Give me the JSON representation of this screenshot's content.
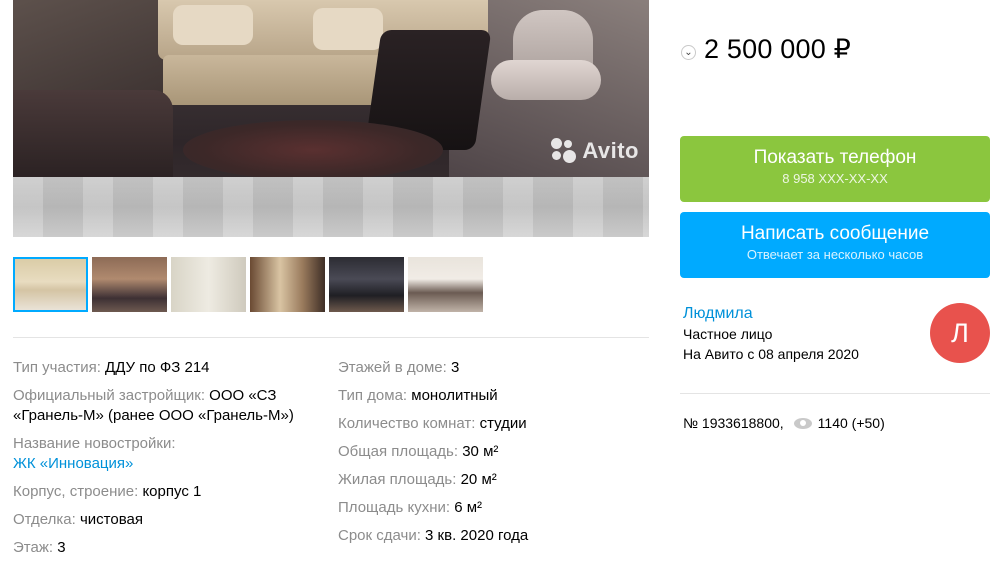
{
  "photo": {
    "watermark": "Avito"
  },
  "thumbnails": [
    {
      "id": "t1",
      "active": true
    },
    {
      "id": "t2",
      "active": false
    },
    {
      "id": "t3",
      "active": false
    },
    {
      "id": "t4",
      "active": false
    },
    {
      "id": "t5",
      "active": false
    },
    {
      "id": "t6",
      "active": false
    }
  ],
  "params": {
    "col1": [
      {
        "key": "Тип участия: ",
        "value": "ДДУ по ФЗ 214"
      },
      {
        "key": "Официальный застройщик: ",
        "value": "ООО «СЗ «Гранель-М» (ранее ООО «Гранель-М»)"
      },
      {
        "key": "Название новостройки:",
        "value": "ЖК «Инновация»"
      },
      {
        "key": "Корпус, строение: ",
        "value": "корпус 1"
      },
      {
        "key": "Отделка: ",
        "value": "чистовая"
      },
      {
        "key": "Этаж: ",
        "value": "3"
      }
    ],
    "col2": [
      {
        "key": "Этажей в доме: ",
        "value": "3"
      },
      {
        "key": "Тип дома: ",
        "value": "монолитный"
      },
      {
        "key": "Количество комнат: ",
        "value": "студии"
      },
      {
        "key": "Общая площадь: ",
        "value": "30 м²"
      },
      {
        "key": "Жилая площадь: ",
        "value": "20 м²"
      },
      {
        "key": "Площадь кухни: ",
        "value": "6 м²"
      },
      {
        "key": "Срок сдачи: ",
        "value": "3 кв. 2020 года"
      }
    ]
  },
  "price": {
    "chevron": "⌄",
    "value": "2 500 000 ₽"
  },
  "buttons": {
    "phone_label": "Показать телефон",
    "phone_sub": "8 958 XXX-XX-XX",
    "message_label": "Написать сообщение",
    "message_sub": "Отвечает за несколько часов"
  },
  "seller": {
    "name": "Людмила",
    "type": "Частное лицо",
    "since": "На Авито с 08 апреля 2020",
    "avatar_letter": "Л"
  },
  "meta": {
    "number": "№ 1933618800,",
    "views": "1140 (+50)"
  },
  "colors": {
    "phone_button": "#8bc63e",
    "message_button": "#00aaff",
    "link": "#0091d9",
    "avatar": "#e8524d"
  }
}
